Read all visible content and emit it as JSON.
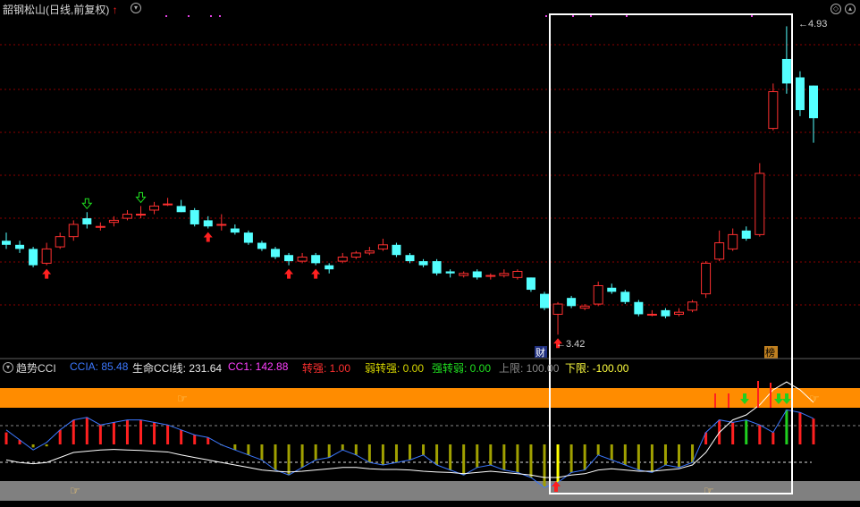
{
  "window": {
    "stock_title": "韶钢松山(日线,前复权)",
    "up_arrow_glyph": "↑"
  },
  "price_chart": {
    "high_label": "4.93",
    "low_label": "3.42",
    "cai_badge": "财",
    "bang_badge": "榜",
    "colors": {
      "up": "#ff3030",
      "down": "#54ffff",
      "grid": "#8b0000",
      "highlight_box": "#ffffff"
    }
  },
  "indicator": {
    "name": "趋势CCI",
    "values": [
      {
        "label": "CCIA: 85.48",
        "color": "#3c78ff"
      },
      {
        "label": "生命CCI线: 231.64",
        "color": "#e8e8e8"
      },
      {
        "label": "CC1: 142.88",
        "color": "#ff40ff"
      },
      {
        "label": "转强: 1.00",
        "color": "#ff3030"
      },
      {
        "label": "弱转强: 0.00",
        "color": "#d8d800"
      },
      {
        "label": "强转弱: 0.00",
        "color": "#20e020"
      },
      {
        "label": "上限: 100.00",
        "color": "#888888"
      },
      {
        "label": "下限: -100.00",
        "color": "#ffff40"
      }
    ],
    "colors": {
      "upper_band": "#ff8c00",
      "lower_band": "#808080",
      "red_bar": "#ff2020",
      "olive_bar": "#a0a000",
      "green_bar": "#20d020",
      "yellow_bar": "#ffff00"
    }
  },
  "chart_data": {
    "type": "candlestick",
    "series": [
      {
        "name": "price",
        "ohlc": [
          [
            3.88,
            3.86,
            3.92,
            3.84
          ],
          [
            3.86,
            3.84,
            3.88,
            3.82
          ],
          [
            3.84,
            3.76,
            3.85,
            3.75
          ],
          [
            3.77,
            3.84,
            3.87,
            3.76
          ],
          [
            3.85,
            3.9,
            3.92,
            3.84
          ],
          [
            3.9,
            3.96,
            3.98,
            3.88
          ],
          [
            3.99,
            3.96,
            4.02,
            3.94
          ],
          [
            3.95,
            3.95,
            3.97,
            3.93
          ],
          [
            3.97,
            3.98,
            4.0,
            3.95
          ],
          [
            3.99,
            4.01,
            4.03,
            3.98
          ],
          [
            4.01,
            4.01,
            4.05,
            3.99
          ],
          [
            4.03,
            4.05,
            4.07,
            4.01
          ],
          [
            4.06,
            4.06,
            4.09,
            4.05
          ],
          [
            4.05,
            4.02,
            4.08,
            4.02
          ],
          [
            4.03,
            3.96,
            4.04,
            3.95
          ],
          [
            3.98,
            3.95,
            4.0,
            3.94
          ],
          [
            3.96,
            3.96,
            4.01,
            3.93
          ],
          [
            3.94,
            3.92,
            3.96,
            3.91
          ],
          [
            3.92,
            3.87,
            3.93,
            3.86
          ],
          [
            3.87,
            3.84,
            3.88,
            3.83
          ],
          [
            3.84,
            3.8,
            3.85,
            3.79
          ],
          [
            3.81,
            3.78,
            3.82,
            3.76
          ],
          [
            3.78,
            3.8,
            3.82,
            3.77
          ],
          [
            3.81,
            3.77,
            3.82,
            3.76
          ],
          [
            3.76,
            3.74,
            3.77,
            3.72
          ],
          [
            3.78,
            3.8,
            3.82,
            3.77
          ],
          [
            3.8,
            3.82,
            3.83,
            3.79
          ],
          [
            3.82,
            3.83,
            3.85,
            3.81
          ],
          [
            3.84,
            3.86,
            3.89,
            3.83
          ],
          [
            3.86,
            3.81,
            3.87,
            3.8
          ],
          [
            3.81,
            3.78,
            3.82,
            3.77
          ],
          [
            3.78,
            3.76,
            3.79,
            3.75
          ],
          [
            3.78,
            3.72,
            3.79,
            3.71
          ],
          [
            3.73,
            3.72,
            3.74,
            3.7
          ],
          [
            3.71,
            3.72,
            3.73,
            3.7
          ],
          [
            3.73,
            3.7,
            3.74,
            3.69
          ],
          [
            3.71,
            3.71,
            3.72,
            3.69
          ],
          [
            3.71,
            3.72,
            3.74,
            3.7
          ],
          [
            3.7,
            3.73,
            3.74,
            3.69
          ],
          [
            3.7,
            3.64,
            3.7,
            3.63
          ],
          [
            3.62,
            3.55,
            3.63,
            3.54
          ],
          [
            3.52,
            3.57,
            3.58,
            3.42
          ],
          [
            3.6,
            3.56,
            3.61,
            3.55
          ],
          [
            3.55,
            3.56,
            3.57,
            3.54
          ],
          [
            3.57,
            3.66,
            3.68,
            3.56
          ],
          [
            3.65,
            3.63,
            3.67,
            3.62
          ],
          [
            3.63,
            3.58,
            3.64,
            3.57
          ],
          [
            3.58,
            3.52,
            3.59,
            3.51
          ],
          [
            3.52,
            3.52,
            3.54,
            3.51
          ],
          [
            3.54,
            3.51,
            3.55,
            3.5
          ],
          [
            3.52,
            3.53,
            3.55,
            3.51
          ],
          [
            3.54,
            3.58,
            3.59,
            3.53
          ],
          [
            3.62,
            3.77,
            3.78,
            3.6
          ],
          [
            3.79,
            3.87,
            3.93,
            3.78
          ],
          [
            3.84,
            3.91,
            3.94,
            3.83
          ],
          [
            3.93,
            3.89,
            3.95,
            3.88
          ],
          [
            3.91,
            4.21,
            4.26,
            3.9
          ],
          [
            4.43,
            4.61,
            4.65,
            4.42
          ],
          [
            4.77,
            4.65,
            4.93,
            4.6
          ],
          [
            4.68,
            4.52,
            4.71,
            4.49
          ],
          [
            4.64,
            4.48,
            4.64,
            4.36
          ]
        ]
      }
    ],
    "arrow_signals": [
      {
        "index": 3,
        "type": "buy"
      },
      {
        "index": 6,
        "type": "sell"
      },
      {
        "index": 10,
        "type": "sell"
      },
      {
        "index": 15,
        "type": "buy"
      },
      {
        "index": 21,
        "type": "buy"
      },
      {
        "index": 23,
        "type": "buy"
      },
      {
        "index": 41,
        "type": "buy"
      }
    ],
    "indicator_series": [
      {
        "name": "CCIA",
        "values": [
          40,
          0,
          -40,
          -10,
          40,
          80,
          90,
          60,
          70,
          80,
          80,
          70,
          60,
          40,
          20,
          10,
          -20,
          -40,
          -60,
          -80,
          -120,
          -140,
          -110,
          -80,
          -70,
          -40,
          -60,
          -90,
          -100,
          -90,
          -80,
          -60,
          -100,
          -120,
          -140,
          -110,
          -100,
          -120,
          -130,
          -150,
          -190,
          -170,
          -130,
          -120,
          -60,
          -80,
          -100,
          -120,
          -130,
          -100,
          -110,
          -90,
          30,
          80,
          70,
          80,
          60,
          30,
          120,
          110,
          85.48
        ]
      },
      {
        "name": "生命CCI线",
        "values": [
          -80,
          -90,
          -95,
          -90,
          -70,
          -50,
          -45,
          -40,
          -38,
          -40,
          -42,
          -45,
          -48,
          -60,
          -70,
          -80,
          -90,
          -100,
          -110,
          -120,
          -125,
          -128,
          -125,
          -120,
          -115,
          -110,
          -110,
          -115,
          -118,
          -118,
          -120,
          -125,
          -128,
          -130,
          -135,
          -130,
          -125,
          -130,
          -135,
          -140,
          -150,
          -150,
          -140,
          -135,
          -120,
          -115,
          -120,
          -125,
          -125,
          -120,
          -115,
          -100,
          -50,
          30,
          80,
          100,
          140,
          200,
          231.64,
          200,
          150
        ]
      }
    ],
    "indicator_bars": [
      30,
      0,
      -30,
      -10,
      40,
      80,
      90,
      60,
      70,
      80,
      80,
      70,
      60,
      40,
      20,
      10,
      -20,
      -40,
      -60,
      -80,
      -120,
      -140,
      -110,
      -80,
      -70,
      -40,
      -60,
      -90,
      -100,
      -90,
      -80,
      -60,
      -100,
      -120,
      -140,
      -110,
      -100,
      -120,
      -130,
      -150,
      -190,
      -170,
      -130,
      -120,
      -60,
      -80,
      -100,
      -120,
      -130,
      -100,
      -110,
      -90,
      30,
      80,
      70,
      80,
      60,
      30,
      120,
      110,
      85
    ],
    "ylim_price": [
      3.36,
      4.98
    ],
    "ylim_indicator": [
      -200,
      200
    ]
  }
}
